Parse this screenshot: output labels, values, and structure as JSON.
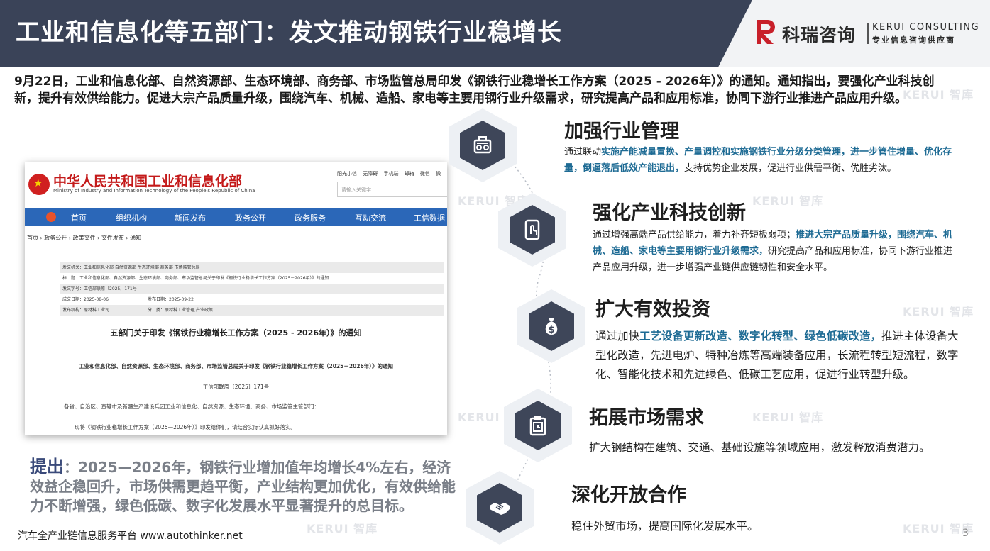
{
  "header": {
    "title": "工业和信息化等五部门：发文推动钢铁行业稳增长",
    "brand_cn": "科瑞咨询",
    "brand_en": "KERUI CONSULTING",
    "brand_sub": "专业信息咨询供应商",
    "brand_color": "#c8202a"
  },
  "intro": "9月22日，工业和信息化部、自然资源部、生态环境部、商务部、市场监管总局印发《钢铁行业稳增长工作方案（2025 - 2026年）》的通知。通知指出，要强化产业科技创新，提升有效供给能力。促进大宗产品质量升级，围绕汽车、机械、造船、家电等主要用钢行业升级需求，研究提高产品和应用标准，协同下游行业推进产品应用升级。",
  "watermark": "KERUI 智库",
  "document": {
    "ministry_cn": "中华人民共和国工业和信息化部",
    "ministry_en": "Ministry of Industry and Information Technology of the People's Republic of China",
    "top_links": "阳光小信 无障碍 手机端 邮箱 微信 微",
    "search_placeholder": "请输入关键字",
    "nav": [
      "首页",
      "组织机构",
      "新闻发布",
      "政务公开",
      "政务服务",
      "互动交流",
      "工信数据"
    ],
    "breadcrumb": "首页 › 政务公开 › 政策文件 › 文件发布 › 通知",
    "meta": {
      "issuer_label": "发文机关：",
      "issuer": "工业和信息化部 自然资源部 生态环境部 商务部 市场监管总局",
      "title_label": "标　题：",
      "title": "工业和信息化部、自然资源部、生态环境部、商务部、市场监管总局关于印发《钢铁行业稳增长工作方案（2025－2026年）》的通知",
      "doc_no_label": "发文字号：",
      "doc_no": "工信部联原〔2025〕171号",
      "date_label": "成文日期：",
      "date": "2025-08-06",
      "pub_label": "发布日期：",
      "pub": "2025-09-22",
      "org_label": "发布机构：",
      "org": "原材料工业司",
      "cat_label": "分　类：",
      "cat": "原材料工业管理,产业政策"
    },
    "heading": "五部门关于印发《钢铁行业稳增长工作方案（2025 - 2026年）》的通知",
    "subheading": "工业和信息化部、自然资源部、生态环境部、商务部、市场监管总局关于印发《钢铁行业稳增长工作方案（2025－2026年）》的通知",
    "doc_no_line": "工信部联原〔2025〕171号",
    "para1": "各省、自治区、直辖市及新疆生产建设兵团工业和信息化、自然资源、生态环境、商务、市场监管主管部门：",
    "para2": "现将《钢铁行业稳增长工作方案（2025—2026年）》印发给你们，请结合实际认真抓好落实。"
  },
  "proposal": {
    "key": "提出",
    "text": "：2025—2026年，钢铁行业增加值年均增长4%左右，经济效益企稳回升，市场供需更趋平衡，产业结构更加优化，有效供给能力不断增强，绿色低碳、数字化发展水平显著提升的总目标。"
  },
  "sections": [
    {
      "title": "加强行业管理",
      "icon": "radio-icon",
      "pre": "通过联动",
      "hl": "实施产能减量置换、产量调控和实施钢铁行业分级分类管理，进一步管住增量、优化存量，倒逼落后低效产能退出，",
      "post": "支持优势企业发展，促进行业供需平衡、优胜劣汰。"
    },
    {
      "title": "强化产业科技创新",
      "icon": "touch-tablet-icon",
      "pre": "通过增强高端产品供给能力，着力补齐短板弱项；",
      "hl": "推进大宗产品质量升级，围绕汽车、机械、造船、家电等主要用钢行业升级需求，",
      "post": "研究提高产品和应用标准，协同下游行业推进产品应用升级，进一步增强产业链供应链韧性和安全水平。"
    },
    {
      "title": "扩大有效投资",
      "icon": "money-bag-icon",
      "pre": "通过加快",
      "hl": "工艺设备更新改造、数字化转型、绿色低碳改造，",
      "post": "推进主体设备大型化改造，先进电炉、特种冶炼等高端装备应用，长流程转型短流程，数字化、智能化技术和先进绿色、低碳工艺应用，促进行业转型升级。"
    },
    {
      "title": "拓展市场需求",
      "icon": "clipboard-clock-icon",
      "pre": "扩大钢结构在建筑、交通、基础设施等领域应用，激发释放消费潜力。",
      "hl": "",
      "post": ""
    },
    {
      "title": "深化开放合作",
      "icon": "handshake-icon",
      "pre": "稳住外贸市场，提高国际化发展水平。",
      "hl": "",
      "post": ""
    }
  ],
  "footer": "汽车全产业链信息服务平台 www.autothinker.net",
  "page_number": "3"
}
